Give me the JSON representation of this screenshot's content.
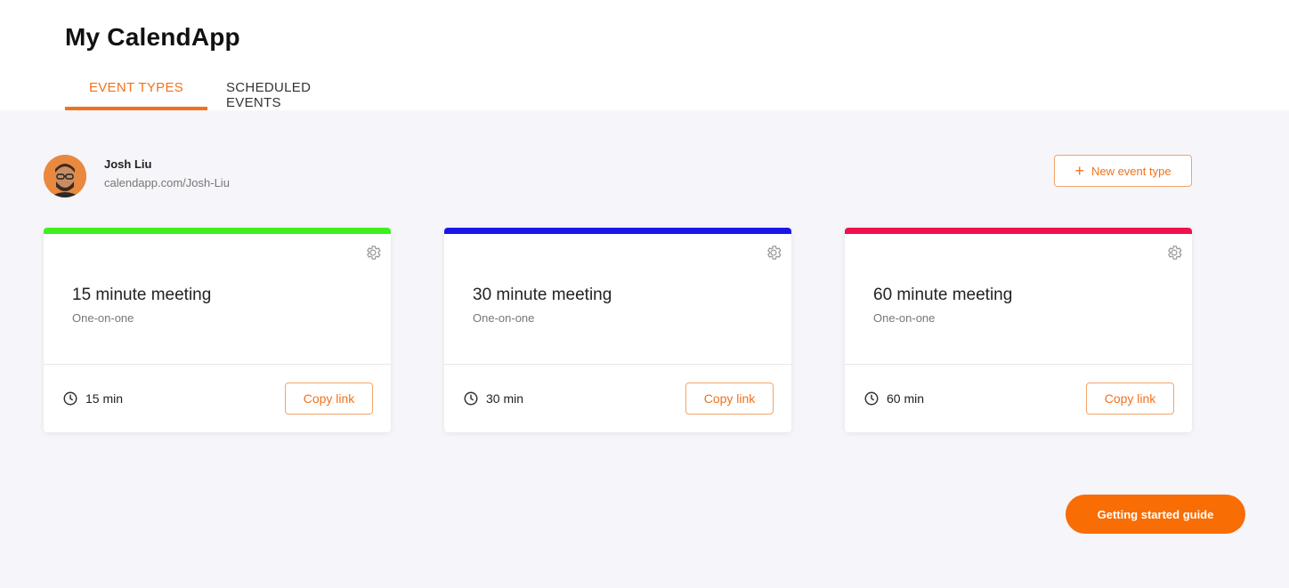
{
  "app": {
    "title": "My CalendApp"
  },
  "tabs": [
    {
      "label": "EVENT TYPES",
      "active": true
    },
    {
      "label": "SCHEDULED EVENTS",
      "active": false
    }
  ],
  "user": {
    "name": "Josh Liu",
    "url": "calendapp.com/Josh-Liu"
  },
  "actions": {
    "new_event_label": "New event type",
    "guide_label": "Getting started guide"
  },
  "colors": {
    "accent": "#f2711c",
    "guide_button": "#f96d05"
  },
  "events": [
    {
      "title": "15 minute meeting",
      "subtitle": "One-on-one",
      "duration": "15 min",
      "copy_label": "Copy link",
      "color": "#3df01e"
    },
    {
      "title": "30 minute meeting",
      "subtitle": "One-on-one",
      "duration": "30 min",
      "copy_label": "Copy link",
      "color": "#1a16e8"
    },
    {
      "title": "60 minute meeting",
      "subtitle": "One-on-one",
      "duration": "60 min",
      "copy_label": "Copy link",
      "color": "#f0104e"
    }
  ]
}
